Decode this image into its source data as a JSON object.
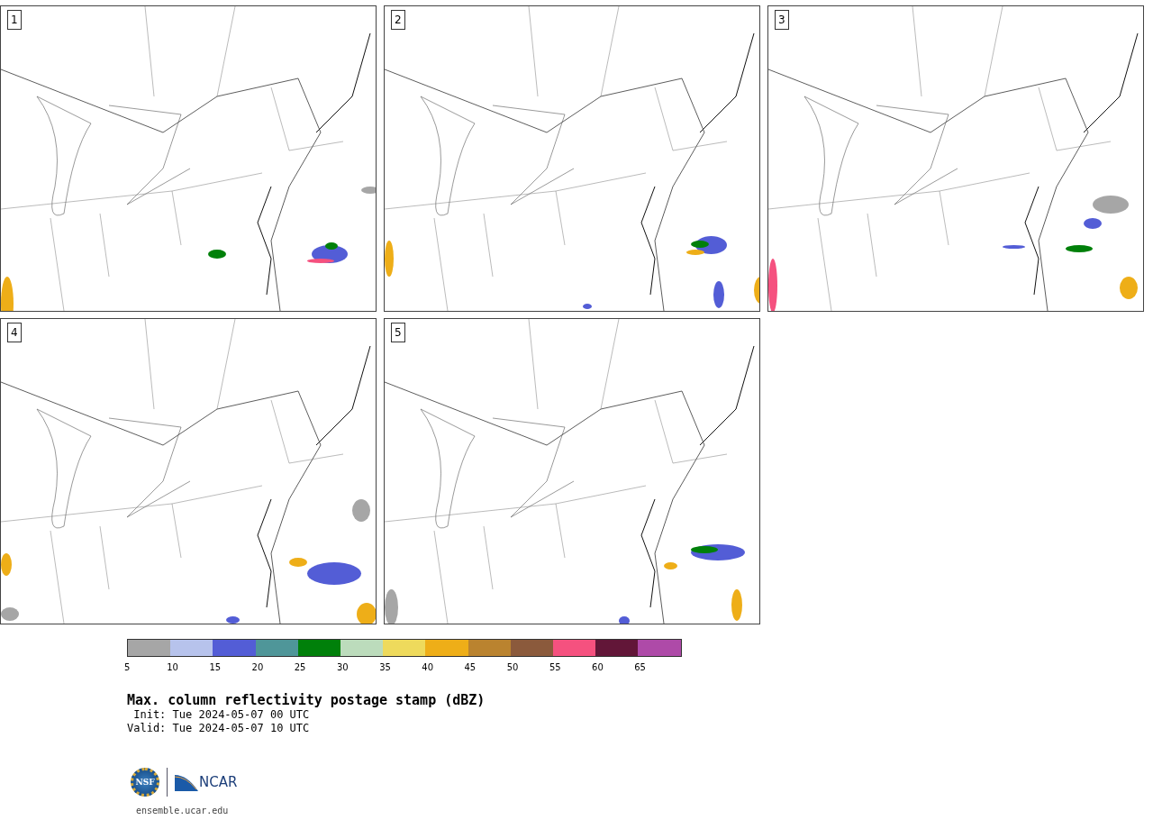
{
  "panels": [
    {
      "label": "1"
    },
    {
      "label": "2"
    },
    {
      "label": "3"
    },
    {
      "label": "4"
    },
    {
      "label": "5"
    }
  ],
  "colorbar": {
    "segments": [
      {
        "color": "#a6a6a6"
      },
      {
        "color": "#b7c3ec"
      },
      {
        "color": "#535dd6"
      },
      {
        "color": "#4f9699"
      },
      {
        "color": "#00800a"
      },
      {
        "color": "#bcdcbc"
      },
      {
        "color": "#eeda5c"
      },
      {
        "color": "#eeae18"
      },
      {
        "color": "#ba832f"
      },
      {
        "color": "#8b5a3c"
      },
      {
        "color": "#f5517f"
      },
      {
        "color": "#621638"
      },
      {
        "color": "#ae4aa8"
      }
    ],
    "ticks": [
      "5",
      "10",
      "15",
      "20",
      "25",
      "30",
      "35",
      "40",
      "45",
      "50",
      "55",
      "60",
      "65"
    ]
  },
  "title": "Max. column reflectivity postage stamp (dBZ)",
  "init": " Init: Tue 2024-05-07 00 UTC",
  "valid": "Valid: Tue 2024-05-07 10 UTC",
  "logos": {
    "nsf": "NSF",
    "ncar": "NCAR"
  },
  "url": "ensemble.ucar.edu"
}
